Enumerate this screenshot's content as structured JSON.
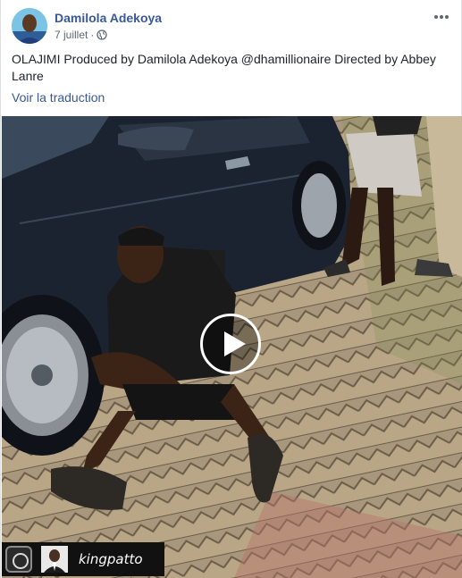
{
  "post": {
    "author": "Damilola Adekoya",
    "date": "7 juillet",
    "separator": "·",
    "privacy_icon": "globe-icon",
    "more_icon": "more-options-icon",
    "text": "OLAJIMI Produced by Damilola Adekoya @dhamillionaire Directed by Abbey Lanre",
    "translate_link": "Voir la traduction"
  },
  "video": {
    "play_icon": "play-icon",
    "watermark_name": "kingpatto"
  }
}
